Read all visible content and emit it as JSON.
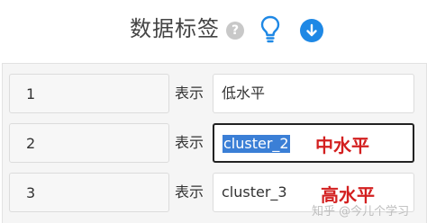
{
  "header": {
    "title": "数据标签",
    "help_glyph": "?"
  },
  "rows": [
    {
      "index": "1",
      "label": "表示",
      "value": "低水平",
      "annotation": ""
    },
    {
      "index": "2",
      "label": "表示",
      "value": "cluster_2",
      "annotation": "中水平"
    },
    {
      "index": "3",
      "label": "表示",
      "value": "cluster_3",
      "annotation": "高水平"
    }
  ],
  "watermark": "知乎 @今儿个学习",
  "colors": {
    "accent": "#1e88e5",
    "annotation": "#d32020",
    "selection": "#3b7fd6"
  },
  "icons": [
    "help-icon",
    "lightbulb-icon",
    "download-icon"
  ]
}
